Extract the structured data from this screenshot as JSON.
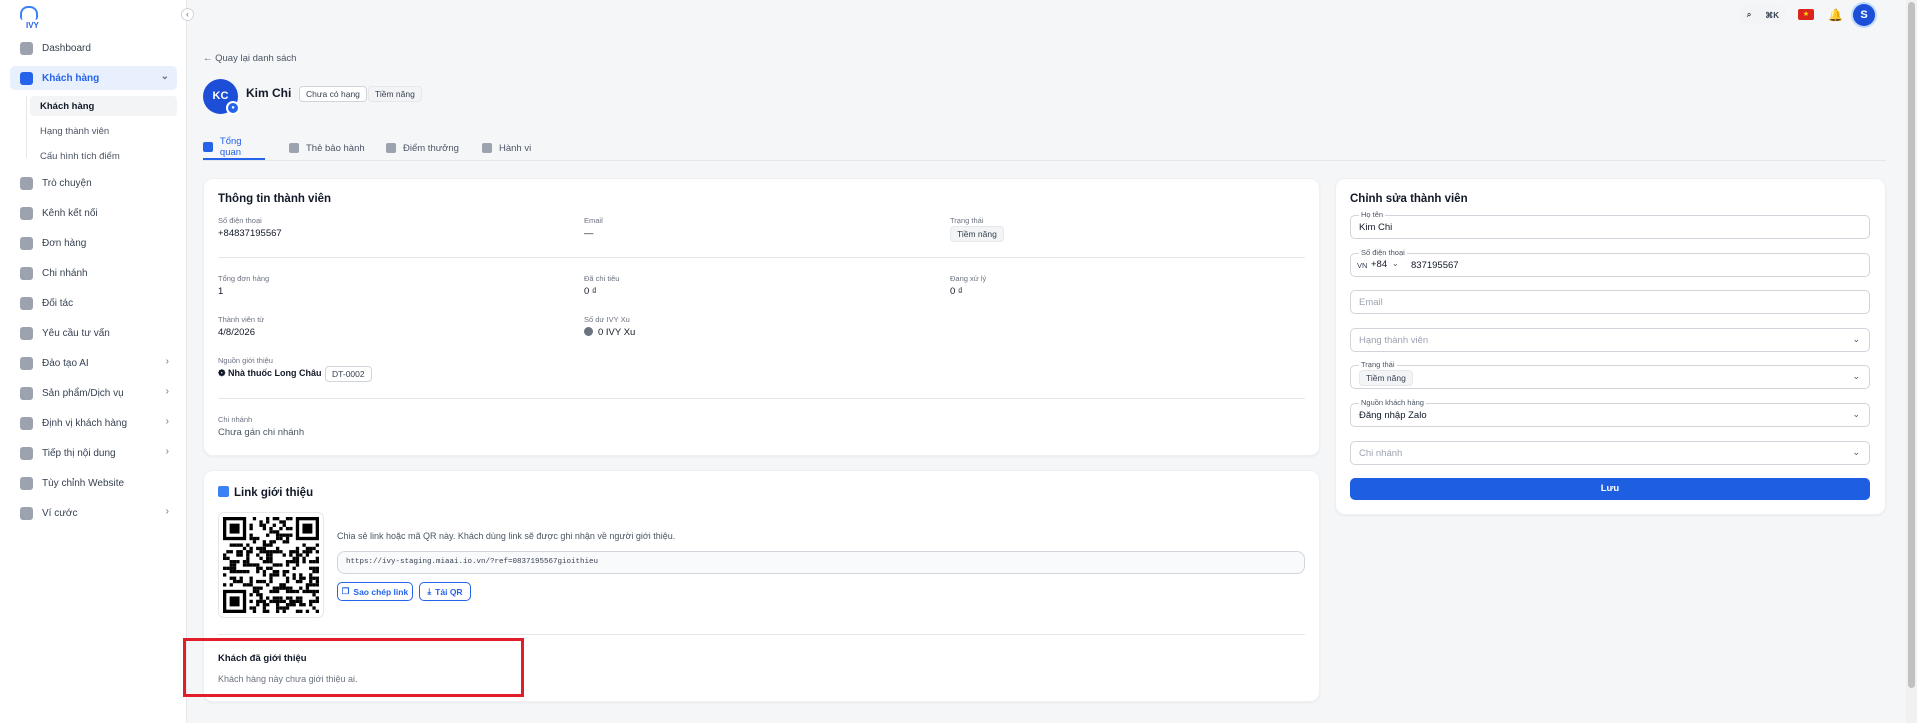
{
  "brand": {
    "name": "IVY",
    "accent": "#2563eb"
  },
  "sidebar": {
    "items": [
      {
        "label": "Dashboard",
        "icon": "home-icon"
      },
      {
        "label": "Khách hàng",
        "icon": "users-icon"
      },
      {
        "label": "Trò chuyện",
        "icon": "chat-icon"
      },
      {
        "label": "Kênh kết nối",
        "icon": "connect-icon"
      },
      {
        "label": "Đơn hàng",
        "icon": "bag-icon"
      },
      {
        "label": "Chi nhánh",
        "icon": "building-icon"
      },
      {
        "label": "Đối tác",
        "icon": "handshake-icon"
      },
      {
        "label": "Yêu cầu tư vấn",
        "icon": "inbox-icon"
      },
      {
        "label": "Đào tạo AI",
        "icon": "brain-icon"
      },
      {
        "label": "Sản phẩm/Dịch vụ",
        "icon": "tooth-icon"
      },
      {
        "label": "Định vị khách hàng",
        "icon": "target-icon"
      },
      {
        "label": "Tiếp thị nội dung",
        "icon": "document-icon"
      },
      {
        "label": "Tùy chỉnh Website",
        "icon": "website-icon"
      },
      {
        "label": "Ví cước",
        "icon": "wallet-icon"
      }
    ],
    "sub_items": [
      {
        "label": "Khách hàng"
      },
      {
        "label": "Hạng thành viên"
      },
      {
        "label": "Cấu hình tích điểm"
      }
    ]
  },
  "topbar": {
    "shortcut": "⌘K"
  },
  "header": {
    "back_link": "← Quay lại danh sách",
    "avatar_initials": "KC",
    "name": "Kim Chi",
    "tags": [
      "Chưa có hạng",
      "Tiềm năng"
    ],
    "user_initial": "S"
  },
  "tabs": [
    {
      "label": "Tổng quan"
    },
    {
      "label": "Thẻ bảo hành"
    },
    {
      "label": "Điểm thưởng"
    },
    {
      "label": "Hành vi"
    }
  ],
  "member_info": {
    "title": "Thông tin thành viên",
    "phone_label": "Số điện thoại",
    "phone": "+84837195567",
    "email_label": "Email",
    "email": "—",
    "status_label": "Trạng thái",
    "status": "Tiềm năng",
    "orders_label": "Tổng đơn hàng",
    "orders": "1",
    "spent_label": "Đã chi tiêu",
    "spent": "0 ₫",
    "processing_label": "Đang xử lý",
    "processing": "0 ₫",
    "member_since_label": "Thành viên từ",
    "member_since": "4/8/2026",
    "balance_label": "Số dư IVY Xu",
    "balance": "0 IVY Xu",
    "referral_source_label": "Nguồn giới thiệu",
    "referral_source": "Nhà thuốc Long Châu",
    "referral_code": "DT-0002",
    "branch_label": "Chi nhánh",
    "branch": "Chưa gán chi nhánh"
  },
  "referral": {
    "title": "Link giới thiệu",
    "description": "Chia sẻ link hoặc mã QR này. Khách dùng link sẽ được ghi nhận về người giới thiệu.",
    "link": "https://ivy-staging.miaai.io.vn/?ref=0837195567gioithieu",
    "copy_button": "Sao chép link",
    "download_button": "Tải QR",
    "referred_title": "Khách đã giới thiệu",
    "referred_empty": "Khách hàng này chưa giới thiệu ai."
  },
  "edit_form": {
    "title": "Chỉnh sửa thành viên",
    "name_label": "Họ tên",
    "name_value": "Kim Chi",
    "phone_label": "Số điện thoại",
    "country_code": "VN",
    "dial_code": "+84",
    "phone_value": "837195567",
    "email_placeholder": "Email",
    "tier_placeholder": "Hạng thành viên",
    "status_label": "Trạng thái",
    "status_value": "Tiềm năng",
    "source_label": "Nguồn khách hàng",
    "source_value": "Đăng nhập Zalo",
    "branch_placeholder": "Chi nhánh",
    "save_button": "Lưu"
  }
}
